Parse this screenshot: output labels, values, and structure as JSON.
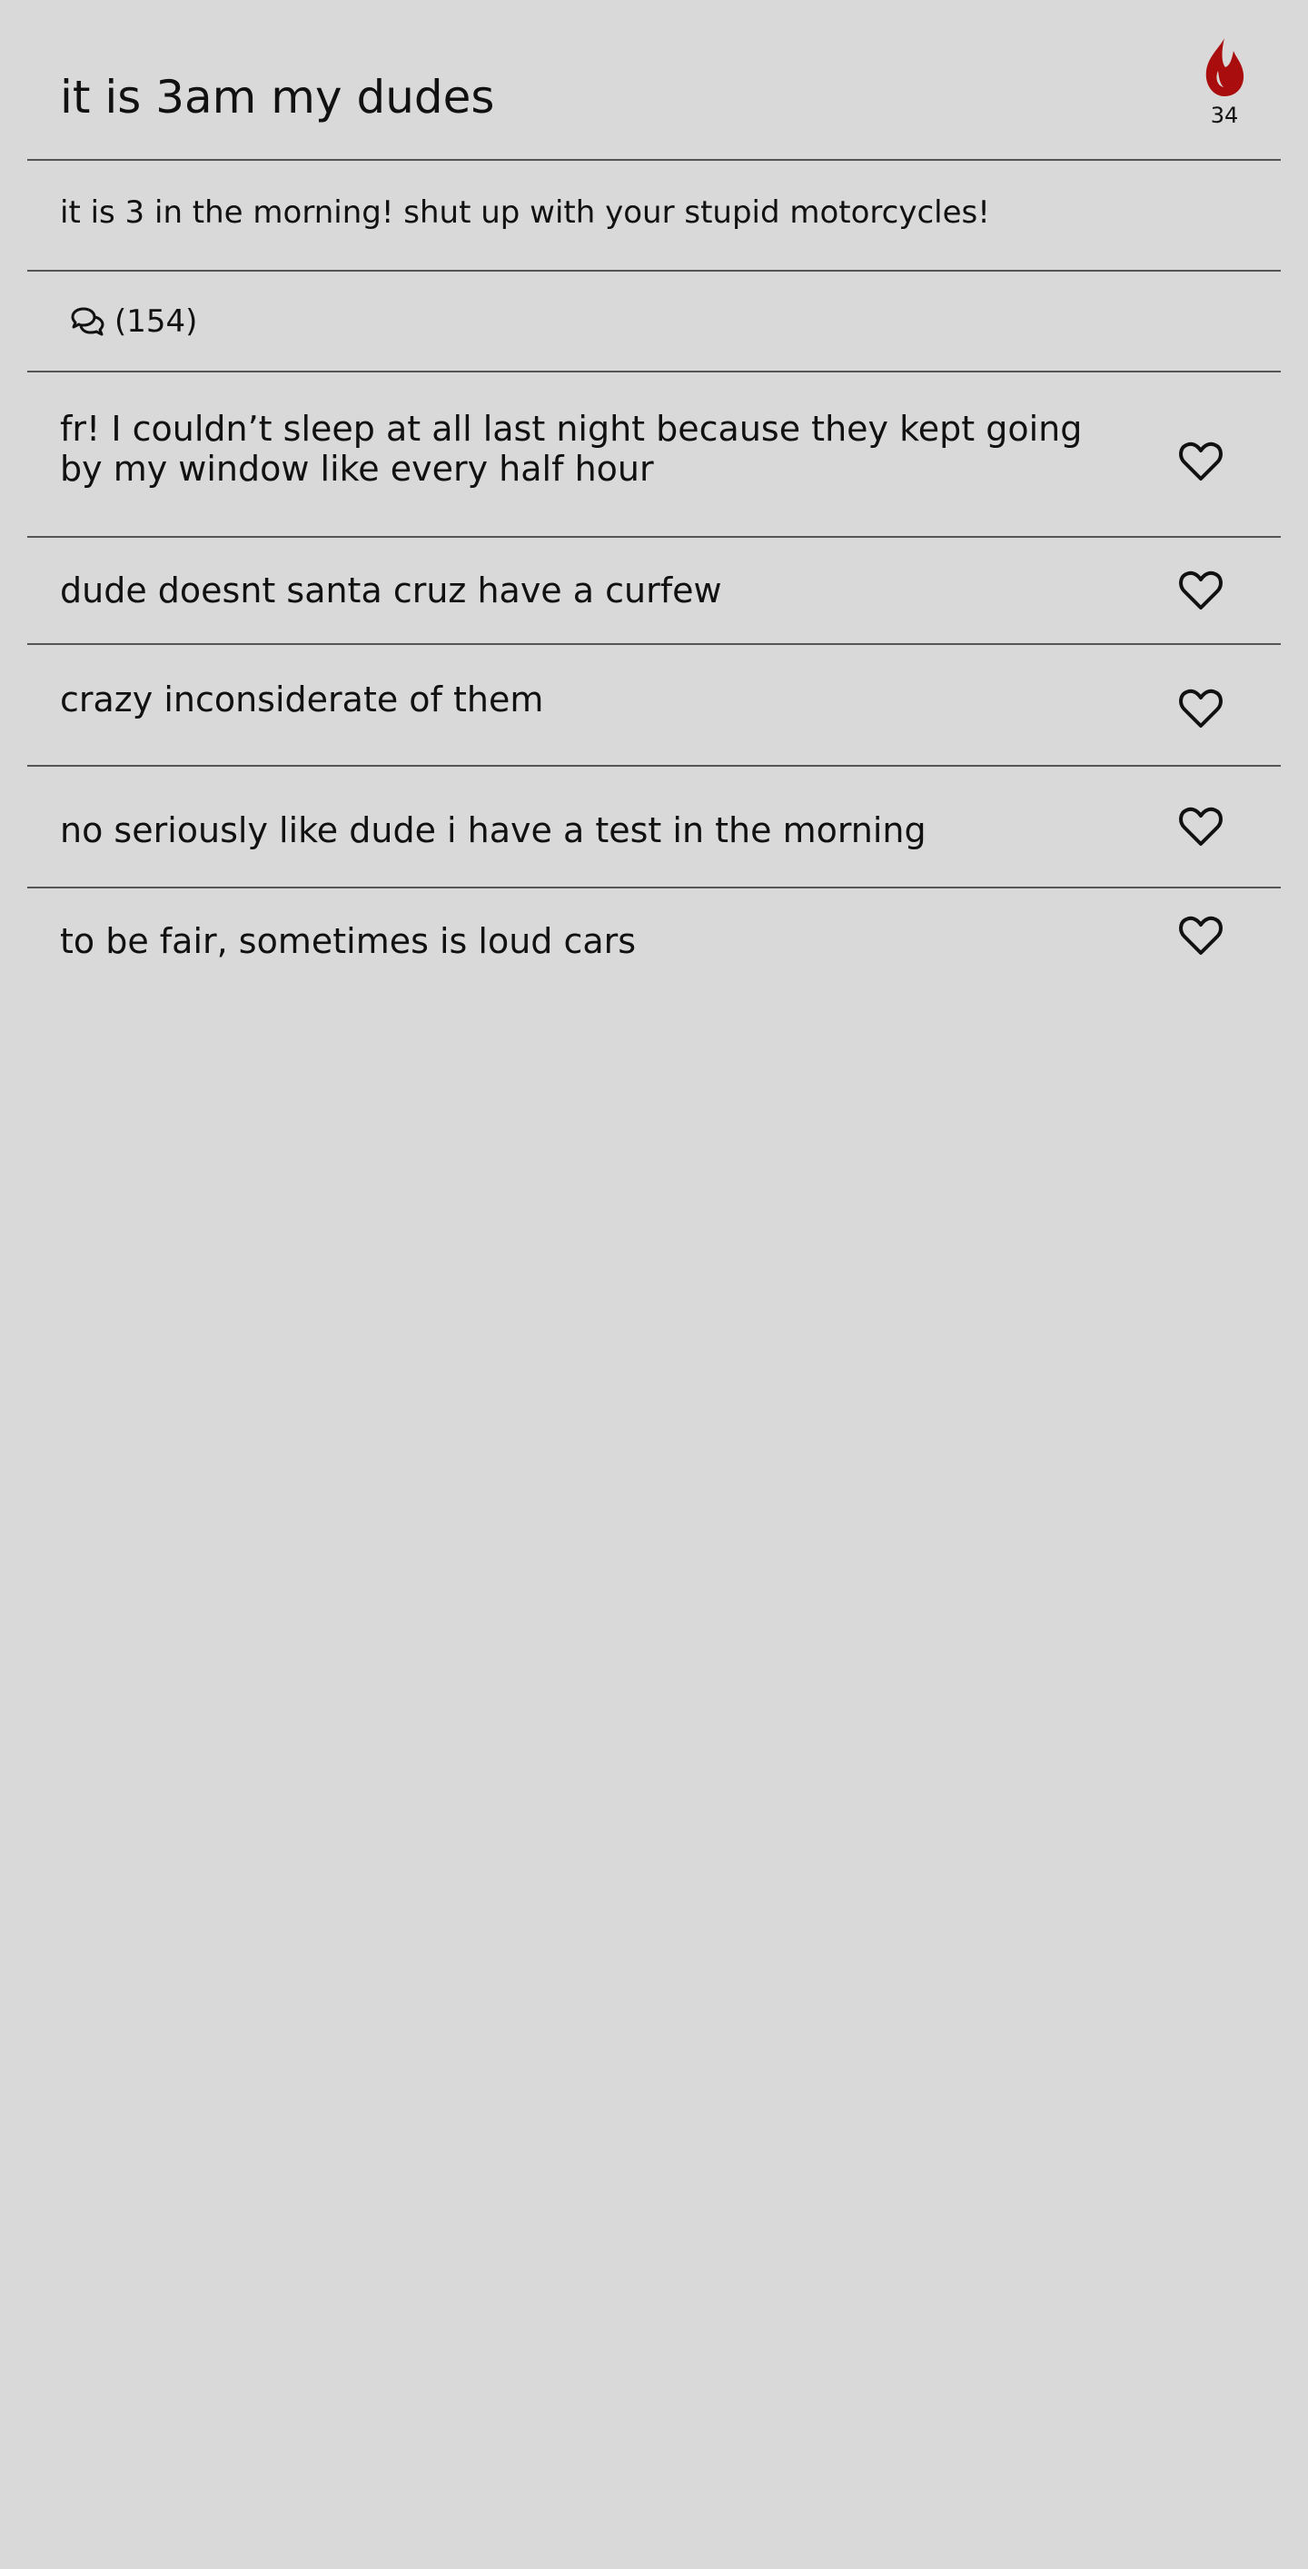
{
  "post": {
    "title": "it is 3am my dudes",
    "body": "it is 3 in the morning! shut up with your stupid motorcycles!",
    "heat_count": "34",
    "comments_label": "(154)"
  },
  "icons": {
    "heat": "flame-icon",
    "comments": "speech-bubbles-icon",
    "like": "heart-outline-icon"
  },
  "colors": {
    "background": "#d9d9d9",
    "flame": "#aa0d0d",
    "text": "#111111",
    "divider": "#555555"
  },
  "replies": [
    {
      "text": "fr! I couldn’t sleep at all last night because they kept going by my window like every half hour"
    },
    {
      "text": "dude doesnt santa cruz have a curfew"
    },
    {
      "text": "crazy inconsiderate of them"
    },
    {
      "text": "no seriously like dude i have a test in the morning"
    },
    {
      "text": "to be fair, sometimes is loud cars"
    }
  ]
}
